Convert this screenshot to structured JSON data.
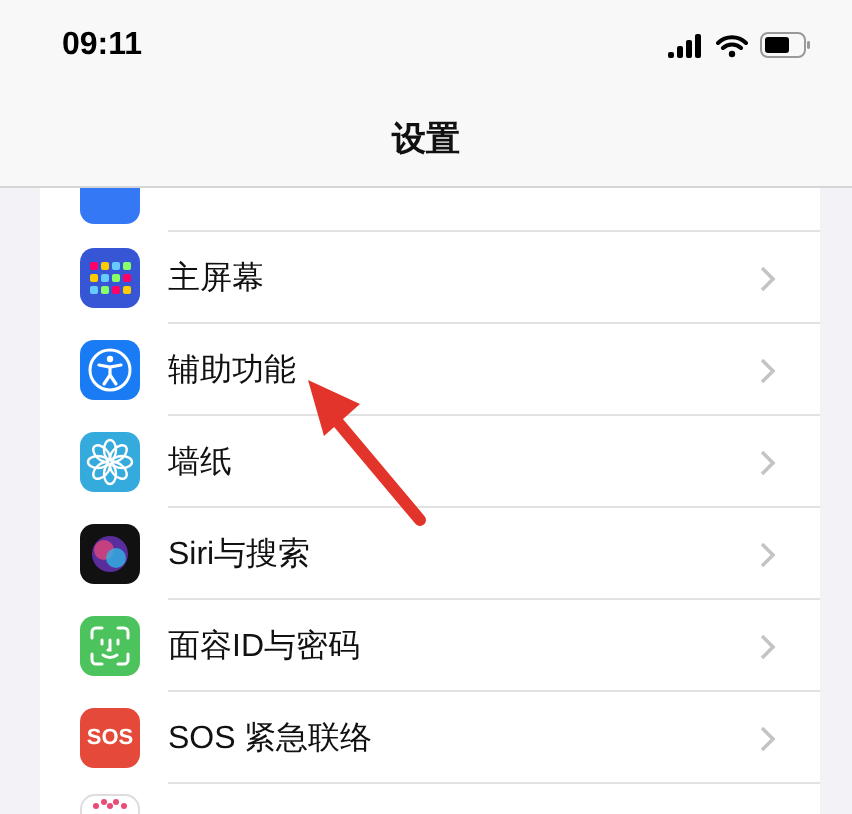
{
  "status_bar": {
    "time": "09:11"
  },
  "title": "设置",
  "rows": [
    {
      "kind": "display",
      "clipped": true
    },
    {
      "kind": "home",
      "label": "主屏幕",
      "clipped": false
    },
    {
      "kind": "accessibility",
      "label": "辅助功能",
      "clipped": false
    },
    {
      "kind": "wallpaper",
      "label": "墙纸",
      "clipped": false
    },
    {
      "kind": "siri",
      "label": "Siri与搜索",
      "clipped": false
    },
    {
      "kind": "faceid",
      "label": "面容ID与密码",
      "clipped": false
    },
    {
      "kind": "sos",
      "label": "SOS 紧急联络",
      "icon_text": "SOS",
      "clipped": false
    },
    {
      "kind": "exposure",
      "clipped": true
    }
  ]
}
